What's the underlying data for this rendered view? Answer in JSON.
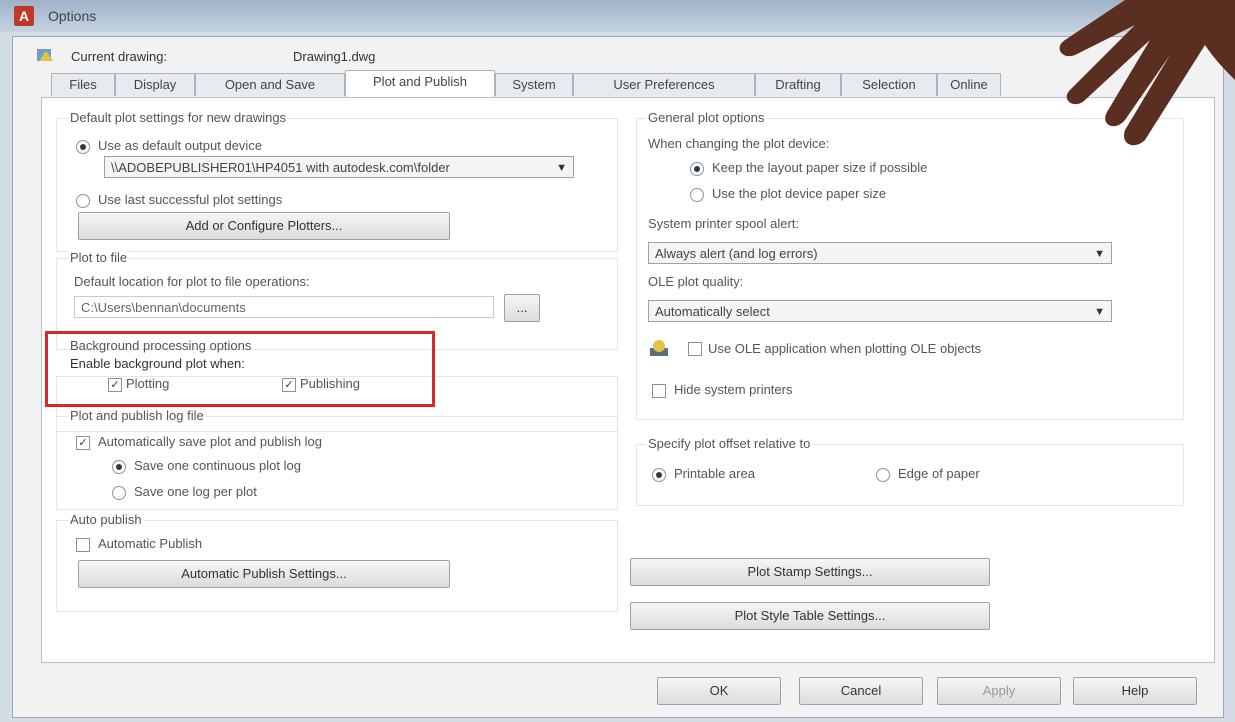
{
  "window": {
    "title": "Options",
    "close_label": "✕"
  },
  "profile": {
    "current_drawing_label": "Current drawing:",
    "drawing_name": "Drawing1.dwg"
  },
  "tabs": [
    {
      "label": "Files"
    },
    {
      "label": "Display"
    },
    {
      "label": "Open and Save"
    },
    {
      "label": "Plot and Publish"
    },
    {
      "label": "System"
    },
    {
      "label": "User Preferences"
    },
    {
      "label": "Drafting"
    },
    {
      "label": "Selection"
    },
    {
      "label": "Online"
    }
  ],
  "default_plot": {
    "title": "Default plot settings for new drawings",
    "use_default_device": "Use as default output device",
    "device_value": "\\\\ADOBEPUBLISHER01\\HP4051 with autodesk.com\\folder",
    "use_last_settings": "Use last successful plot settings",
    "add_configure_button": "Add or Configure Plotters..."
  },
  "plot_to_file": {
    "title": "Plot to file",
    "default_location_label": "Default location for plot to file operations:",
    "location_value": "C:\\Users\\bennan\\documents",
    "browse_label": "..."
  },
  "background": {
    "title": "Background processing options",
    "enable_label": "Enable background plot when:",
    "plotting": "Plotting",
    "publishing": "Publishing"
  },
  "log": {
    "title": "Plot and publish log file",
    "auto_save": "Automatically save plot and publish log",
    "continuous": "Save one continuous plot log",
    "per_plot": "Save one log per plot"
  },
  "auto_publish": {
    "title": "Auto publish",
    "auto_publish_label": "Automatic Publish",
    "settings_button": "Automatic Publish Settings..."
  },
  "general": {
    "title": "General plot options",
    "when_changing": "When changing the plot device:",
    "keep_layout": "Keep the layout paper size if possible",
    "use_device_paper": "Use the plot device paper size",
    "spooler_label": "System printer spool alert:",
    "spooler_value": "Always alert (and log errors)",
    "ole_label": "OLE plot quality:",
    "ole_value": "Automatically select",
    "use_ole_app": "Use OLE application when plotting OLE objects",
    "hide_printers": "Hide system printers"
  },
  "offset": {
    "title": "Specify plot offset relative to",
    "printable_area": "Printable area",
    "edge_of_paper": "Edge of paper"
  },
  "buttons": {
    "plot_stamp": "Plot Stamp Settings...",
    "plot_style": "Plot Style Table Settings...",
    "ok": "OK",
    "cancel": "Cancel",
    "apply": "Apply",
    "help": "Help"
  },
  "colors": {
    "highlight": "#d9272e",
    "title_icon": "#c0392b"
  }
}
